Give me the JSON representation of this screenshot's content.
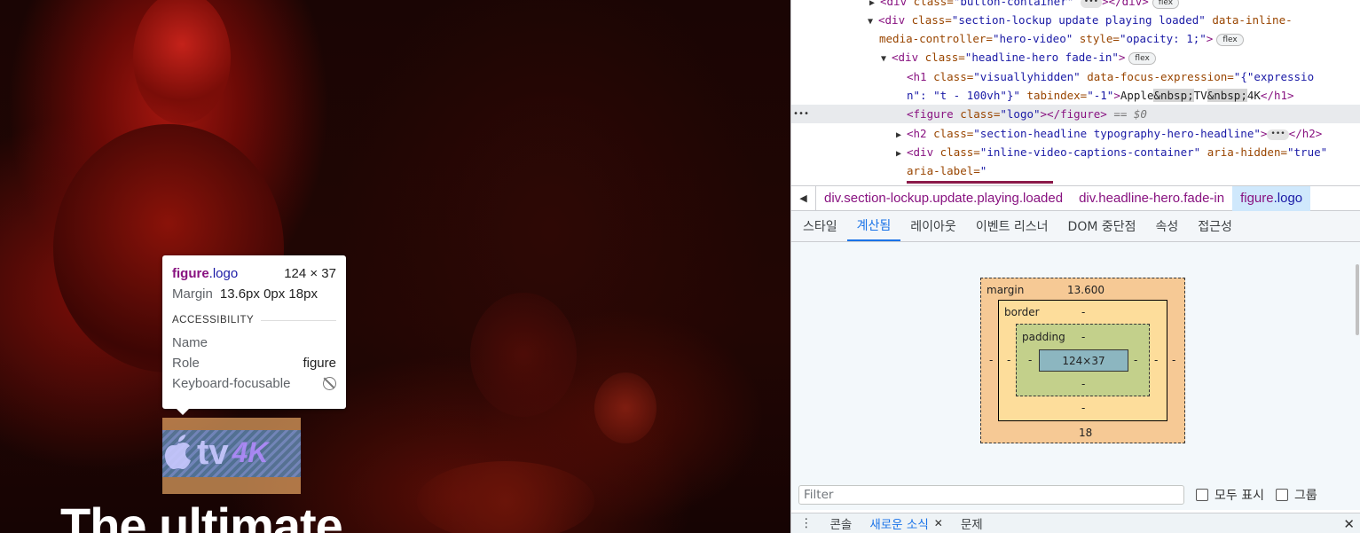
{
  "viewport": {
    "headline": "The ultimate",
    "logo": {
      "tv": "tv",
      "four_k": "4K"
    }
  },
  "tooltip": {
    "element_tag": "figure",
    "element_class": ".logo",
    "size": "124 × 37",
    "margin_label": "Margin",
    "margin_value": "13.6px 0px 18px",
    "section_title": "ACCESSIBILITY",
    "rows": [
      {
        "label": "Name",
        "value": ""
      },
      {
        "label": "Role",
        "value": "figure"
      },
      {
        "label": "Keyboard-focusable",
        "value": ""
      }
    ]
  },
  "dom_tree": {
    "line0": {
      "tag_open": "<div",
      "attr": "class=",
      "val": "\"button-container\"",
      "tag_close": "></div>",
      "badge": "flex"
    },
    "line1": {
      "tag_open": "<div",
      "attr1": "class=",
      "val1": "\"section-lockup update playing loaded\"",
      "attr2": "data-inline-",
      "attr2b": "media-controller=",
      "val2": "\"hero-video\"",
      "attr3": "style=",
      "val3": "\"opacity: 1;\"",
      "tag_close": ">",
      "badge": "flex"
    },
    "line2": {
      "tag_open": "<div",
      "attr": "class=",
      "val": "\"headline-hero fade-in\"",
      "tag_close": ">",
      "badge": "flex"
    },
    "line3": {
      "tag_open": "<h1",
      "attr1": "class=",
      "val1": "\"visuallyhidden\"",
      "attr2": "data-focus-expression=",
      "val2a": "\"{\"expressio",
      "val2b": "n\": \"t - 100vh\"}\"",
      "attr3": "tabindex=",
      "val3": "\"-1\"",
      "text1": "Apple",
      "ent": "&nbsp;",
      "text2": "TV",
      "text3": "4K",
      "tag_close": "</h1>"
    },
    "line4": {
      "tag_open": "<figure",
      "attr": "class=",
      "val": "\"logo\"",
      "tag_close": "></figure>",
      "marker": "== $0",
      "dots": "•••"
    },
    "line5": {
      "tag_open": "<h2",
      "attr": "class=",
      "val": "\"section-headline typography-hero-headline\"",
      "tag_close": "</h2>"
    },
    "line6": {
      "tag_open": "<div",
      "attr1": "class=",
      "val1": "\"inline-video-captions-container\"",
      "attr2": "aria-hidden=",
      "val2": "\"true\"",
      "attr3": "aria-label=",
      "val3": "\""
    }
  },
  "breadcrumb": [
    {
      "tag": "div",
      "cls": ".section-lockup.update.playing.loaded"
    },
    {
      "tag": "div",
      "cls": ".headline-hero.fade-in"
    },
    {
      "tag": "figure",
      "cls": ".logo"
    }
  ],
  "tabs": [
    "스타일",
    "계산됨",
    "레이아웃",
    "이벤트 리스너",
    "DOM 중단점",
    "속성",
    "접근성"
  ],
  "active_tab": "계산됨",
  "box_model": {
    "margin_label": "margin",
    "margin_top": "13.600",
    "margin_bottom": "18",
    "margin_left": "-",
    "margin_right": "-",
    "border_label": "border",
    "border_top": "-",
    "border_bottom": "-",
    "border_left": "-",
    "border_right": "-",
    "padding_label": "padding",
    "padding_top": "-",
    "padding_bottom": "-",
    "padding_left": "-",
    "padding_right": "-",
    "content": "124×37"
  },
  "filter": {
    "placeholder": "Filter",
    "show_all": "모두 표시",
    "group": "그룹"
  },
  "drawer": {
    "more": "⋮",
    "console": "콘솔",
    "whats_new": "새로운 소식",
    "issues": "문제",
    "close": "✕"
  }
}
